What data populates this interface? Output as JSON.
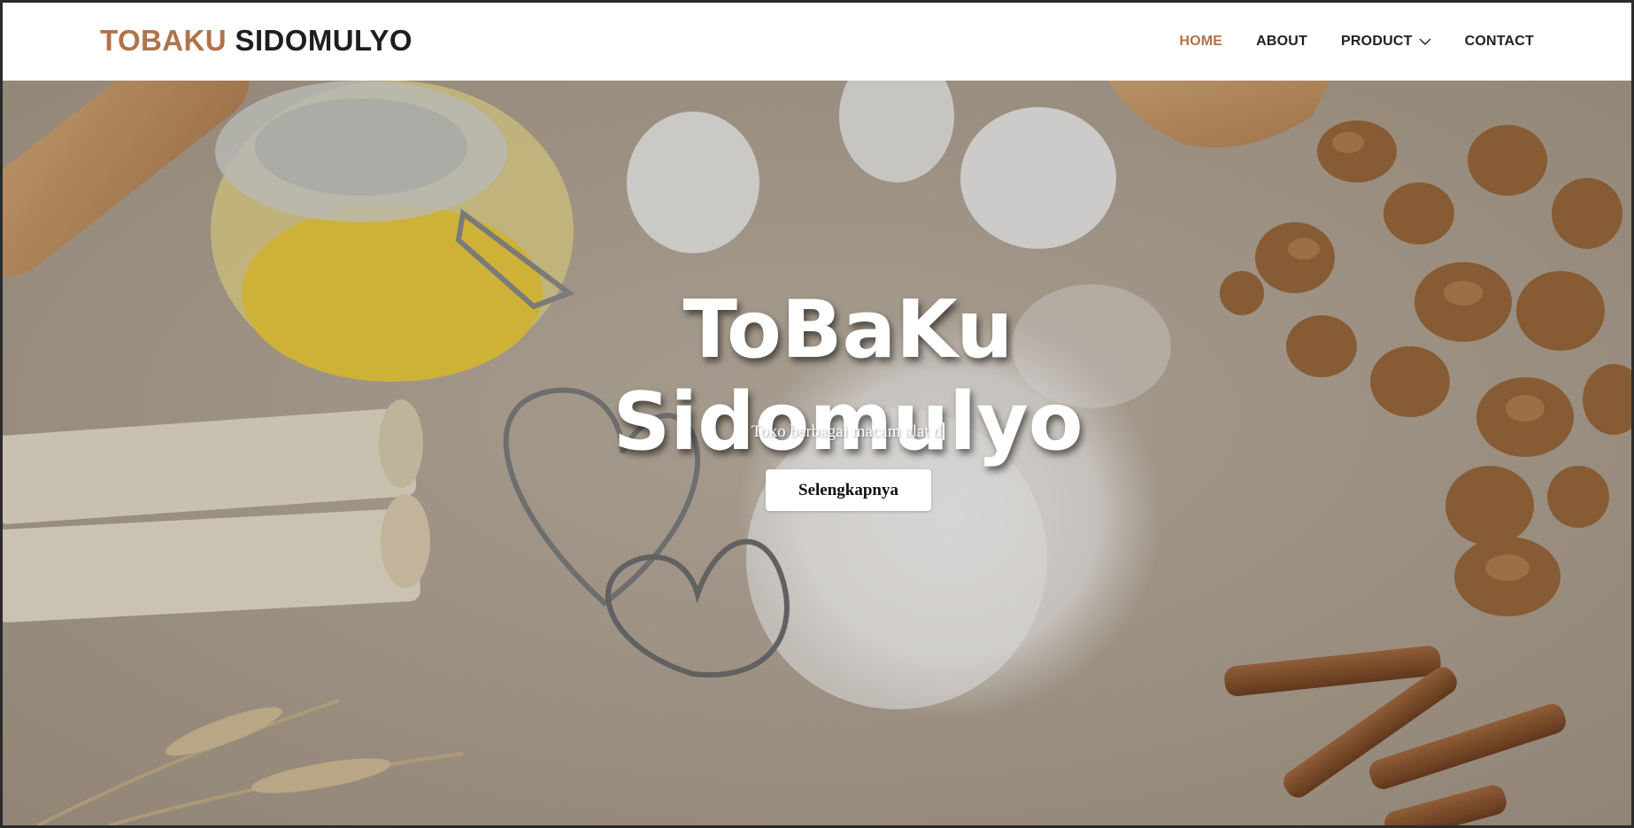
{
  "brand": {
    "part1": "TOBAKU",
    "part2": "SIDOMULYO"
  },
  "nav": {
    "items": [
      {
        "label": "HOME",
        "active": true
      },
      {
        "label": "ABOUT"
      },
      {
        "label": "PRODUCT",
        "dropdown": true
      },
      {
        "label": "CONTACT"
      }
    ]
  },
  "hero": {
    "title_line1": "ToBaKu",
    "title_line2": "Sidomulyo",
    "subtitle": "Toko berbagai macam alat d",
    "button": "Selengkapnya"
  },
  "colors": {
    "accent": "#b0734a",
    "text_dark": "#1e1e1e",
    "hero_bg": "#b7aa9a"
  },
  "icons": {
    "dropdown": "chevron-down-icon"
  }
}
